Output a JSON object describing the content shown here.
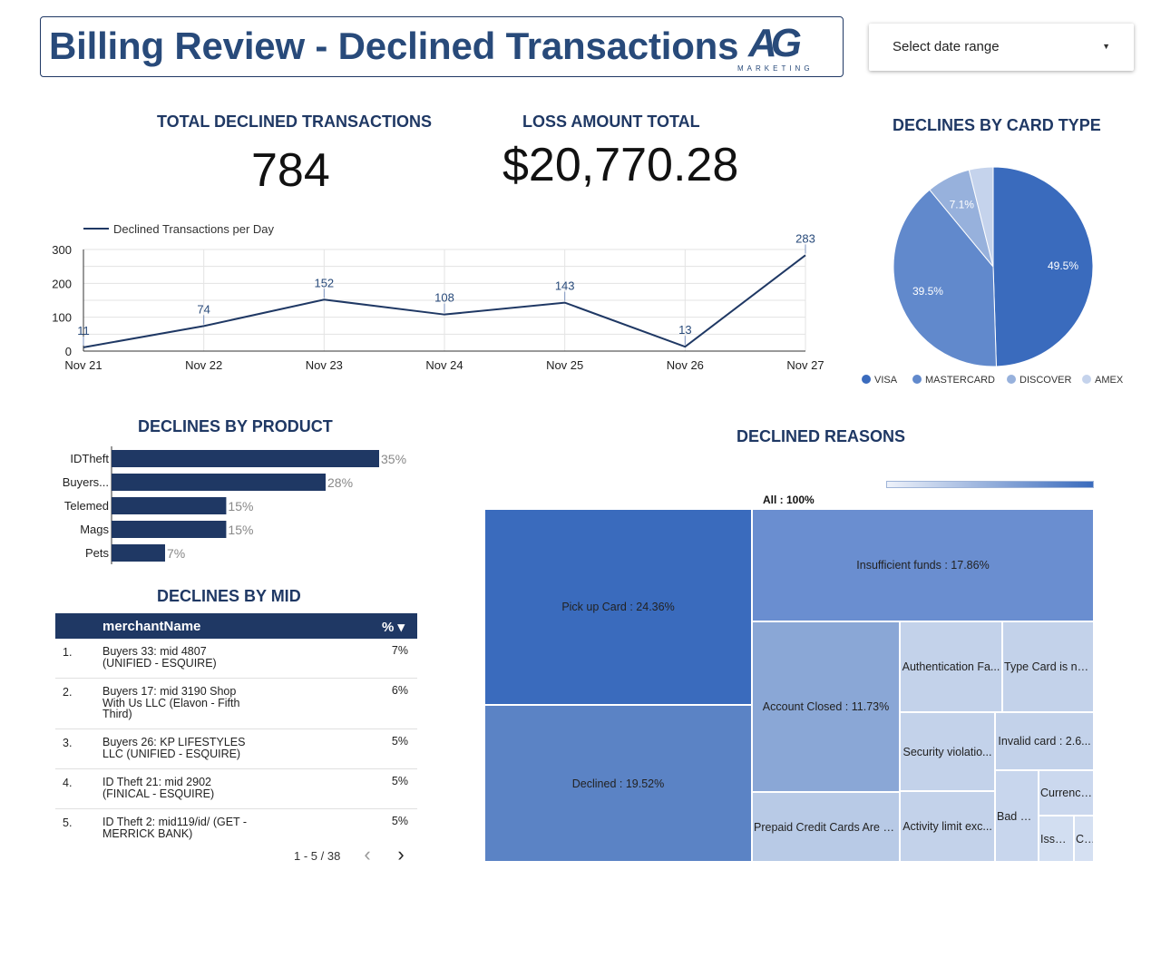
{
  "header": {
    "title": "Billing Review - Declined Transactions",
    "logo_text": "AG",
    "logo_subtext": "MARKETING"
  },
  "date_range": {
    "label": "Select date range"
  },
  "kpis": {
    "total_declined": {
      "label": "TOTAL DECLINED TRANSACTIONS",
      "value": "784"
    },
    "loss_amount": {
      "label": "LOSS AMOUNT TOTAL",
      "value": "$20,770.28"
    }
  },
  "line_chart": {
    "legend": "Declined Transactions per Day"
  },
  "card_type": {
    "title": "DECLINES BY CARD TYPE"
  },
  "product": {
    "title": "DECLINES BY PRODUCT"
  },
  "reasons": {
    "title": "DECLINED REASONS",
    "all_label": "All : 100%"
  },
  "mid": {
    "title": "DECLINES BY MID",
    "col_name": "merchantName",
    "col_pct": "% ▾",
    "rows": [
      {
        "idx": "1.",
        "name": "Buyers 33: mid 4807 (UNIFIED - ESQUIRE)",
        "pct": "7%"
      },
      {
        "idx": "2.",
        "name": "Buyers 17: mid 3190 Shop With Us LLC (Elavon - Fifth Third)",
        "pct": "6%"
      },
      {
        "idx": "3.",
        "name": "Buyers 26: KP LIFESTYLES LLC (UNIFIED - ESQUIRE)",
        "pct": "5%"
      },
      {
        "idx": "4.",
        "name": "ID Theft 21: mid 2902 (FINICAL - ESQUIRE)",
        "pct": "5%"
      },
      {
        "idx": "5.",
        "name": "ID Theft 2: mid119/id/ (GET - MERRICK BANK)",
        "pct": "5%"
      }
    ],
    "pager": "1 - 5 / 38"
  },
  "colors": {
    "navy": "#1f3864",
    "visa": "#3a6bbd",
    "mastercard": "#6189cc",
    "discover": "#97b1dc",
    "amex": "#c5d3ec"
  },
  "chart_data": [
    {
      "type": "line",
      "x": [
        "Nov 21",
        "Nov 22",
        "Nov 23",
        "Nov 24",
        "Nov 25",
        "Nov 26",
        "Nov 27"
      ],
      "series": [
        {
          "name": "Declined Transactions per Day",
          "values": [
            11,
            74,
            152,
            108,
            143,
            13,
            283
          ]
        }
      ],
      "ylim": [
        0,
        300
      ],
      "yticks": [
        0,
        100,
        200,
        300
      ],
      "grid": true,
      "legend": "top-left"
    },
    {
      "type": "pie",
      "title": "DECLINES BY CARD TYPE",
      "labels": [
        "VISA",
        "MASTERCARD",
        "DISCOVER",
        "AMEX"
      ],
      "values": [
        49.5,
        39.5,
        7.1,
        3.9
      ],
      "value_labels": [
        "49.5%",
        "39.5%",
        "7.1%",
        ""
      ],
      "legend": "bottom"
    },
    {
      "type": "bar",
      "orientation": "horizontal",
      "title": "DECLINES BY PRODUCT",
      "categories": [
        "IDTheft",
        "Buyers...",
        "Telemed",
        "Mags",
        "Pets"
      ],
      "values": [
        35,
        28,
        15,
        15,
        7
      ],
      "value_labels": [
        "35%",
        "28%",
        "15%",
        "15%",
        "7%"
      ]
    },
    {
      "type": "treemap",
      "title": "DECLINED REASONS",
      "root": "All : 100%",
      "items": [
        {
          "label": "Pick up Card : 24.36%",
          "value": 24.36
        },
        {
          "label": "Declined : 19.52%",
          "value": 19.52
        },
        {
          "label": "Insufficient funds : 17.86%",
          "value": 17.86
        },
        {
          "label": "Account Closed : 11.73%",
          "value": 11.73
        },
        {
          "label": "Authentication Fa...",
          "value": null
        },
        {
          "label": "Type Card is no...",
          "value": null
        },
        {
          "label": "Security violatio...",
          "value": null
        },
        {
          "label": "Invalid card : 2.6...",
          "value": null
        },
        {
          "label": "Prepaid Credit Cards Are N...",
          "value": null
        },
        {
          "label": "Activity limit exc...",
          "value": null
        },
        {
          "label": "Bad Bi...",
          "value": null
        },
        {
          "label": "Currency...",
          "value": null
        },
        {
          "label": "Issue...",
          "value": null
        },
        {
          "label": "Cl...",
          "value": null
        }
      ]
    }
  ]
}
